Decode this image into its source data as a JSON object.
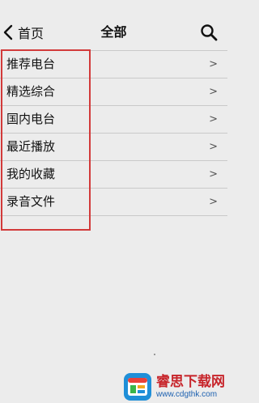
{
  "header": {
    "back_label": "首页",
    "title": "全部",
    "back_icon": "chevron-left-icon",
    "search_icon": "search-icon"
  },
  "list": {
    "items": [
      {
        "label": "推荐电台",
        "chevron": ">"
      },
      {
        "label": "精选综合",
        "chevron": ">"
      },
      {
        "label": "国内电台",
        "chevron": ">"
      },
      {
        "label": "最近播放",
        "chevron": ">"
      },
      {
        "label": "我的收藏",
        "chevron": ">"
      },
      {
        "label": "录音文件",
        "chevron": ">"
      }
    ]
  },
  "annotation": {
    "highlight_color": "#d23a3a"
  },
  "watermark": {
    "name": "睿思下载网",
    "url": "www.cdgthk.com",
    "name_color": "#c7252b",
    "url_color": "#1d61b0"
  }
}
